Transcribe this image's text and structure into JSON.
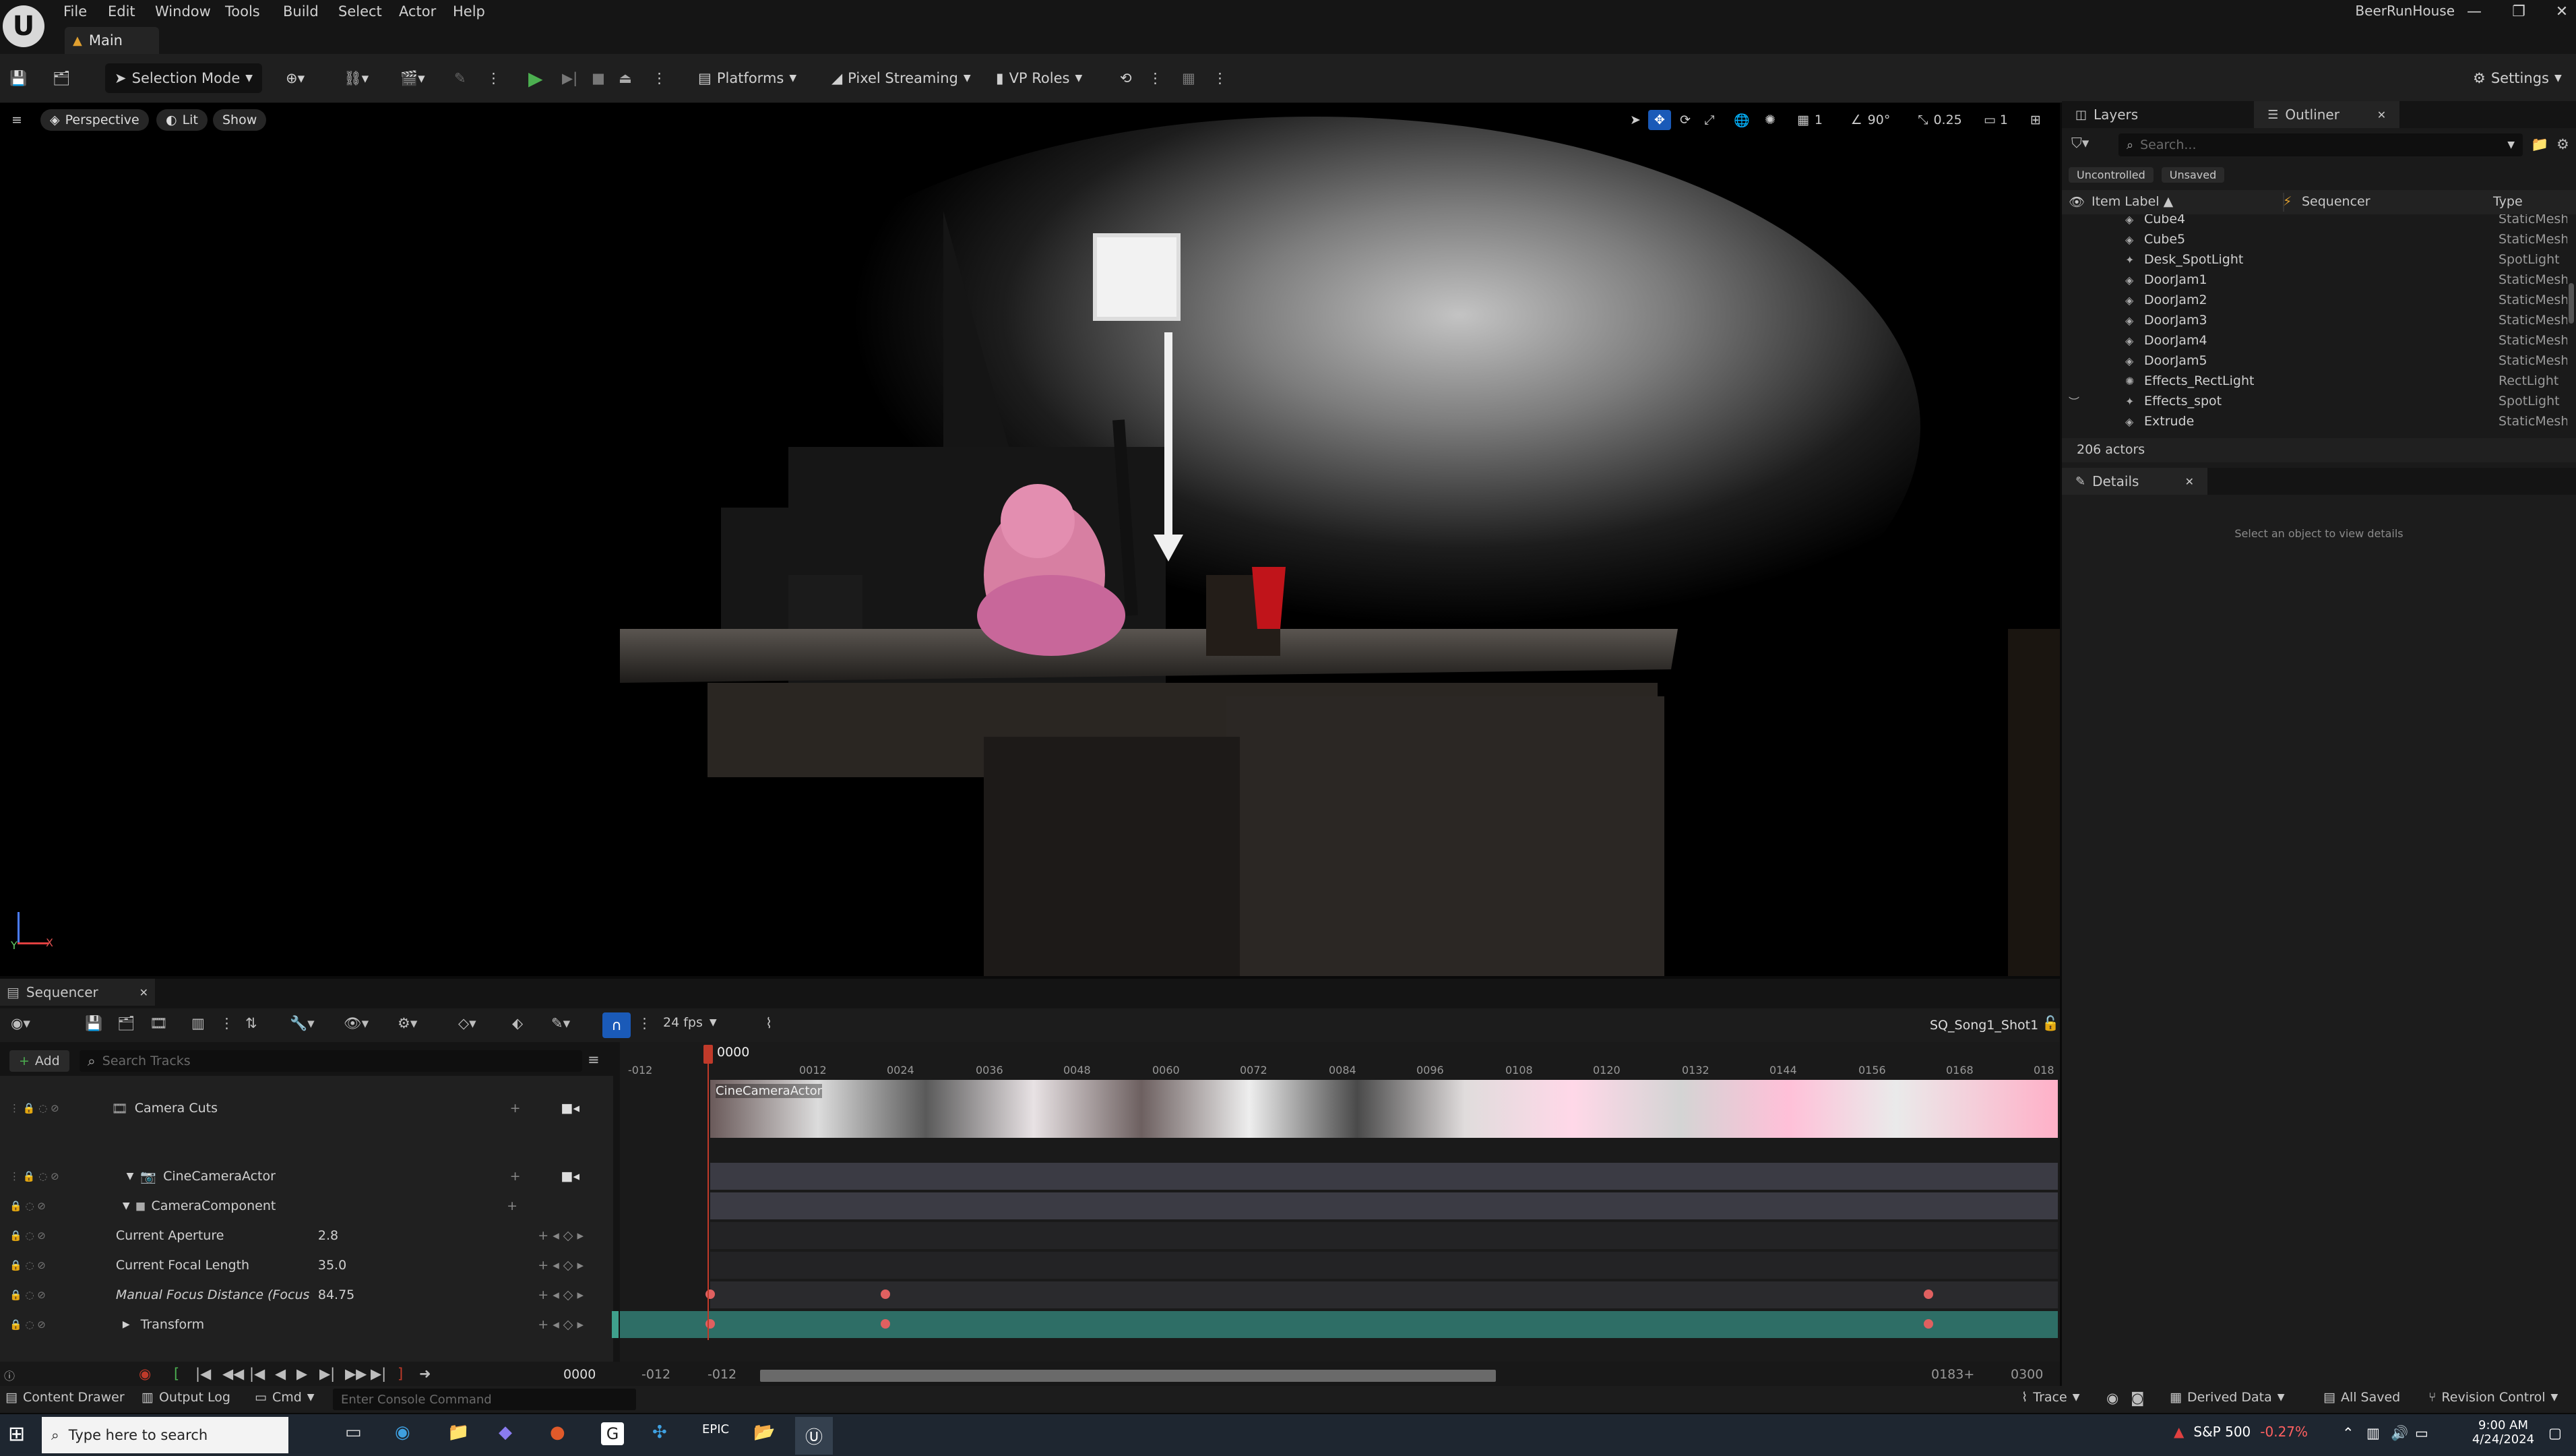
{
  "window": {
    "menu": [
      "File",
      "Edit",
      "Window",
      "Tools",
      "Build",
      "Select",
      "Actor",
      "Help"
    ],
    "level_tab": "Main",
    "project": "BeerRunHouse"
  },
  "toolbar": {
    "mode": "Selection Mode",
    "platforms": "Platforms",
    "pixel_streaming": "Pixel Streaming",
    "vp_roles": "VP Roles",
    "settings": "Settings"
  },
  "viewport": {
    "perspective": "Perspective",
    "lit": "Lit",
    "show": "Show",
    "grid_size": "1",
    "angle": "90°",
    "scale": "0.25",
    "camera_speed": "1",
    "axis_y": "Y",
    "axis_x": "X"
  },
  "outliner": {
    "tabs": [
      "Layers",
      "Outliner"
    ],
    "search_placeholder": "Search...",
    "filters": [
      "Uncontrolled",
      "Unsaved"
    ],
    "columns": {
      "label": "Item Label ▲",
      "sequencer": "Sequencer",
      "type": "Type"
    },
    "rows": [
      {
        "label": "Cube4",
        "type": "StaticMesh"
      },
      {
        "label": "Cube5",
        "type": "StaticMesh"
      },
      {
        "label": "Desk_SpotLight",
        "type": "SpotLight"
      },
      {
        "label": "DoorJam1",
        "type": "StaticMesh"
      },
      {
        "label": "DoorJam2",
        "type": "StaticMesh"
      },
      {
        "label": "DoorJam3",
        "type": "StaticMesh"
      },
      {
        "label": "DoorJam4",
        "type": "StaticMesh"
      },
      {
        "label": "DoorJam5",
        "type": "StaticMesh"
      },
      {
        "label": "Effects_RectLight",
        "type": "RectLight"
      },
      {
        "label": "Effects_spot",
        "type": "SpotLight"
      },
      {
        "label": "Extrude",
        "type": "StaticMesh"
      }
    ],
    "count": "206 actors"
  },
  "details": {
    "tab": "Details",
    "empty": "Select an object to view details"
  },
  "sequencer": {
    "tab": "Sequencer",
    "fps": "24 fps",
    "sequence_name": "SQ_Song1_Shot1",
    "add": "Add",
    "search_placeholder": "Search Tracks",
    "current_frame": "0000",
    "timecode": "0000",
    "ruler": [
      "-012",
      "-012",
      "0012",
      "0024",
      "0036",
      "0048",
      "0060",
      "0072",
      "0084",
      "0096",
      "0108",
      "0120",
      "0132",
      "0144",
      "0156",
      "0168",
      "018"
    ],
    "tracks": [
      {
        "name": "Camera Cuts",
        "value": ""
      },
      {
        "name": "CineCameraActor",
        "value": ""
      },
      {
        "name": "CameraComponent",
        "value": ""
      },
      {
        "name": "Current Aperture",
        "value": "2.8"
      },
      {
        "name": "Current Focal Length",
        "value": "35.0"
      },
      {
        "name": "Manual Focus Distance (Focus",
        "value": "84.75"
      },
      {
        "name": "Transform",
        "value": ""
      }
    ],
    "clip_label": "CineCameraActor",
    "range_start": "-012",
    "range_start2": "-012",
    "range_end": "0183+",
    "range_end2": "0300"
  },
  "statusbar": {
    "content_drawer": "Content Drawer",
    "output_log": "Output Log",
    "cmd": "Cmd",
    "console_placeholder": "Enter Console Command",
    "trace": "Trace",
    "derived_data": "Derived Data",
    "all_saved": "All Saved",
    "revision_control": "Revision Control"
  },
  "taskbar": {
    "search_placeholder": "Type here to search",
    "stock_name": "S&P 500",
    "stock_change": "-0.27%",
    "time": "9:00 AM",
    "date": "4/24/2024"
  },
  "colors": {
    "accent": "#0070e0",
    "play": "#4caf50",
    "key": "#e06060",
    "teal": "#2e6e66"
  }
}
